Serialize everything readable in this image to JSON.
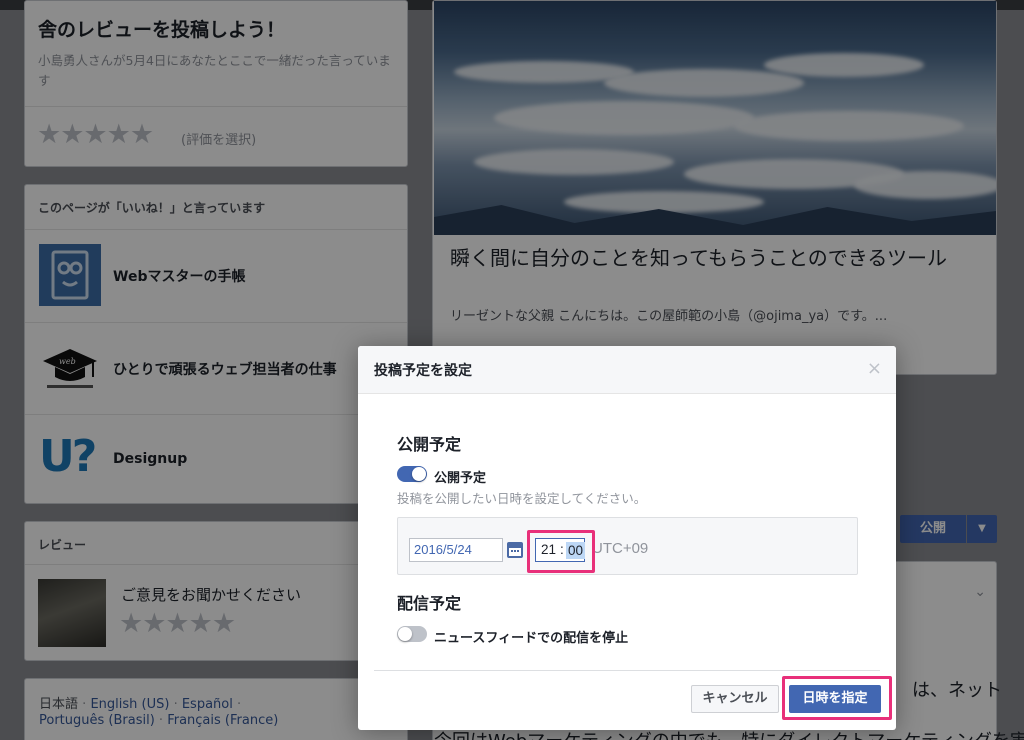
{
  "review": {
    "title": "舎のレビューを投稿しよう！",
    "description": "小島勇人さんが5月4日にあなたとここで一緒だった言っています",
    "stars": "★★★★★",
    "stars_hint": "(評価を選択)"
  },
  "likes": {
    "heading": "このページが「いいね！」と言っています",
    "items": [
      {
        "name": "Webマスターの手帳"
      },
      {
        "name": "ひとりで頑張るウェブ担当者の仕事"
      },
      {
        "name": "Designup"
      }
    ],
    "logo2_text": "web",
    "logo3_text": "U?"
  },
  "reviews": {
    "heading": "レビュー",
    "prompt": "ご意見をお聞かせください",
    "stars": "★★★★★"
  },
  "languages": {
    "line1": [
      "日本語",
      "English (US)",
      "Español"
    ],
    "line2": [
      "Português (Brasil)",
      "Français (France)"
    ],
    "separator": "·"
  },
  "post": {
    "title": "瞬く間に自分のことを知ってもらうことのできるツール",
    "description": "リーゼントな父親 こんにちは。この屋師範の小島（@ojima_ya）です。..."
  },
  "publish": {
    "label": "公開",
    "caret": "▼"
  },
  "feed": {
    "caret": "⌄",
    "text1": "は、ネット",
    "text2": "今回はWebマーケティングの中でも、特にダイレクトマーケティングを実"
  },
  "modal": {
    "title": "投稿予定を設定",
    "close": "×",
    "publish_section": "公開予定",
    "publish_toggle_label": "公開予定",
    "publish_toggle_on": true,
    "publish_help": "投稿を公開したい日時を設定してください。",
    "date_value": "2016/5/24",
    "time_hour": "21",
    "time_colon": ":",
    "time_minute": "00",
    "timezone": "UTC+09",
    "distribution_section": "配信予定",
    "distribution_toggle_label": "ニュースフィードでの配信を停止",
    "distribution_toggle_on": false,
    "cancel_label": "キャンセル",
    "schedule_label": "日時を指定"
  },
  "colors": {
    "accent": "#4267b2",
    "highlight": "#e8307a",
    "link": "#365899"
  }
}
